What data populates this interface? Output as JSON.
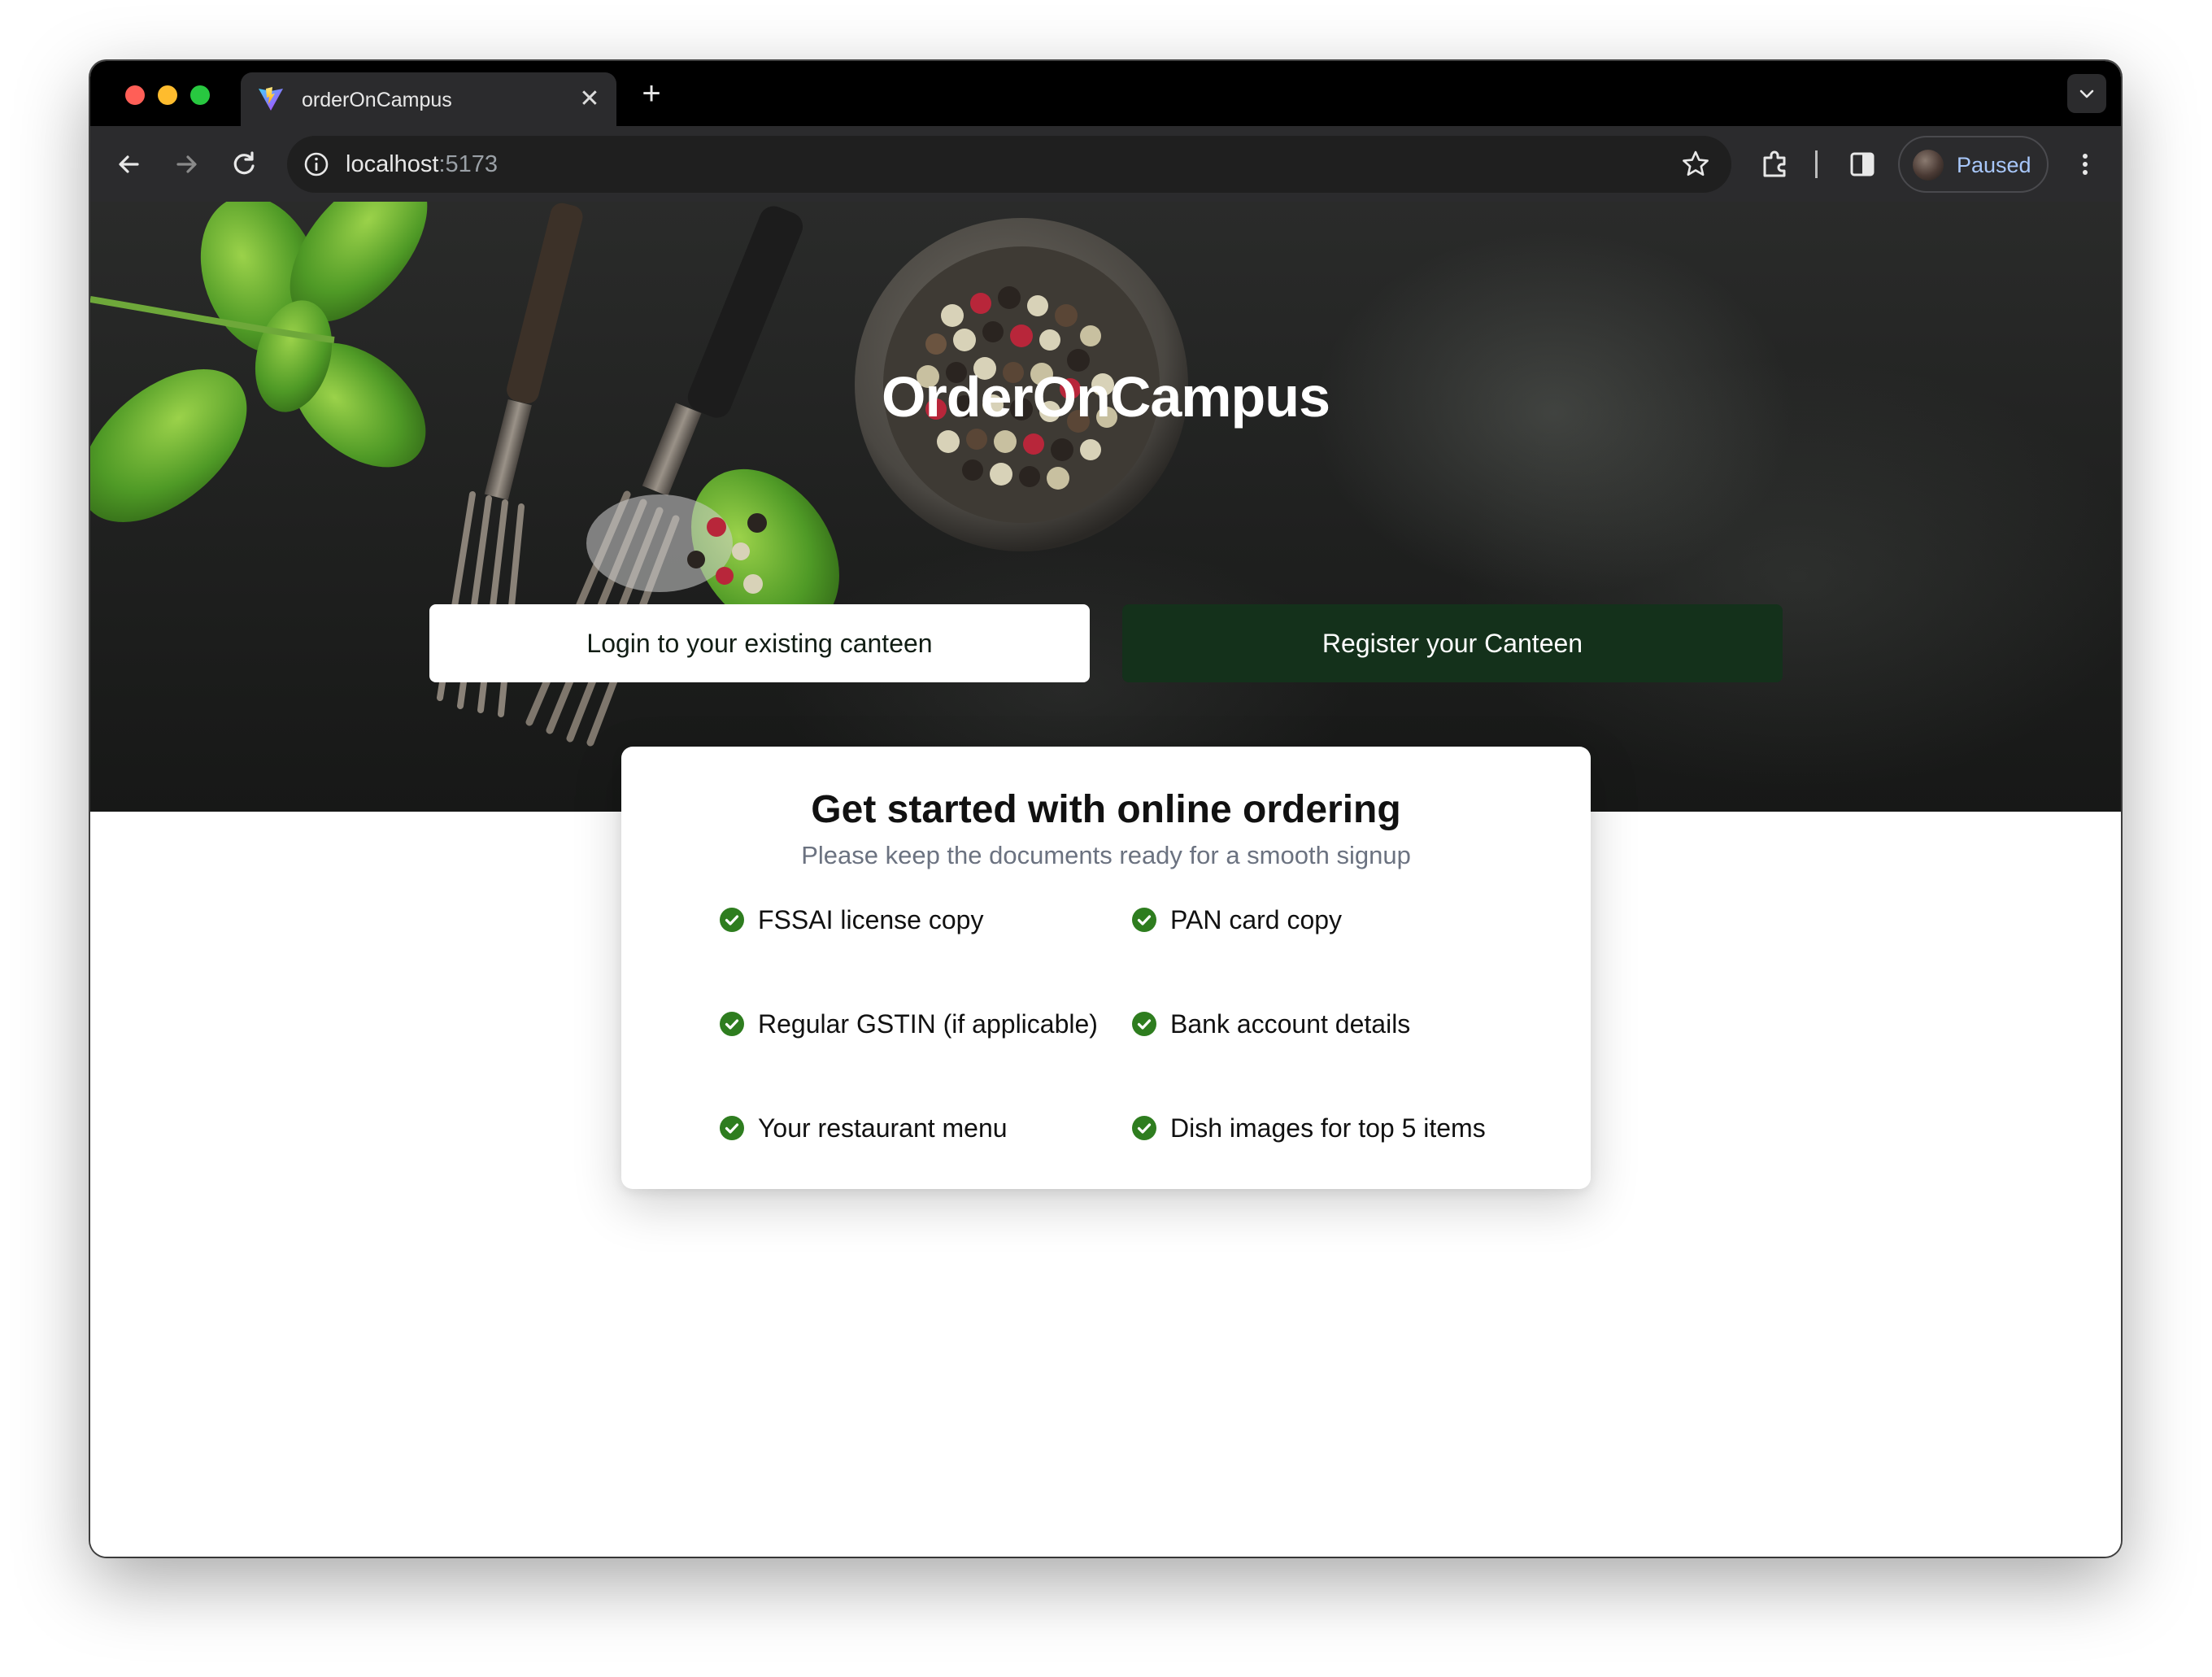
{
  "browser": {
    "tab_title": "orderOnCampus",
    "new_tab_symbol": "+",
    "close_symbol": "✕",
    "url_host": "localhost",
    "url_port": ":5173",
    "profile_label": "Paused"
  },
  "hero": {
    "title": "OrderOnCampus",
    "login_button": "Login to your existing canteen",
    "register_button": "Register your Canteen"
  },
  "card": {
    "title": "Get started with online ordering",
    "subtitle": "Please keep the documents ready for a smooth signup",
    "requirements": [
      "FSSAI license copy",
      "PAN card copy",
      "Regular GSTIN (if applicable)",
      "Bank account details",
      "Your restaurant menu",
      "Dish images for top 5 items"
    ]
  },
  "colors": {
    "check_green": "#2e7d1f",
    "register_button_bg": "#14311b",
    "subtitle_gray": "#6b7280"
  },
  "icons": {
    "back": "arrow-left-icon",
    "forward": "arrow-right-icon",
    "reload": "reload-icon",
    "info": "info-icon",
    "bookmark": "star-icon",
    "extensions": "puzzle-icon",
    "side_panel": "side-panel-icon",
    "menu": "kebab-menu-icon",
    "tab_list": "chevron-down-icon",
    "requirement": "check-circle-icon"
  }
}
